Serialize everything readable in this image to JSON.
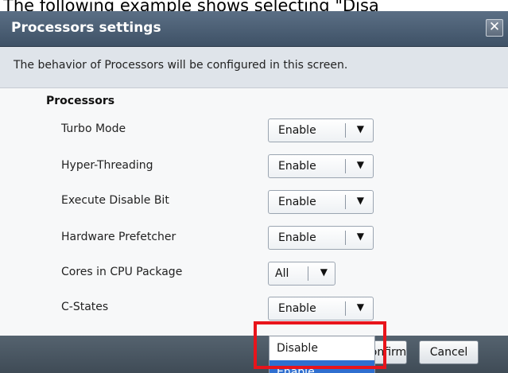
{
  "caption": "The following example shows selecting \"Disa",
  "dialog": {
    "title": "Processors settings",
    "close_label": "✕",
    "description": "The behavior of Processors will be configured in this screen."
  },
  "section": {
    "title": "Processors"
  },
  "settings": [
    {
      "label": "Turbo Mode",
      "value": "Enable"
    },
    {
      "label": "Hyper-Threading",
      "value": "Enable"
    },
    {
      "label": "Execute Disable Bit",
      "value": "Enable"
    },
    {
      "label": "Hardware Prefetcher",
      "value": "Enable"
    },
    {
      "label": "Cores in CPU Package",
      "value": "All"
    },
    {
      "label": "C-States",
      "value": "Enable"
    }
  ],
  "dropdown": {
    "arrow": "▼",
    "options": [
      "Disable",
      "Enable"
    ],
    "selected": "Enable"
  },
  "footer": {
    "confirm_label": "Confirm",
    "cancel_label": "Cancel"
  },
  "colors": {
    "titlebar": "#4b5e73",
    "selection": "#2f6fd0",
    "highlight_box": "#e8141b"
  }
}
